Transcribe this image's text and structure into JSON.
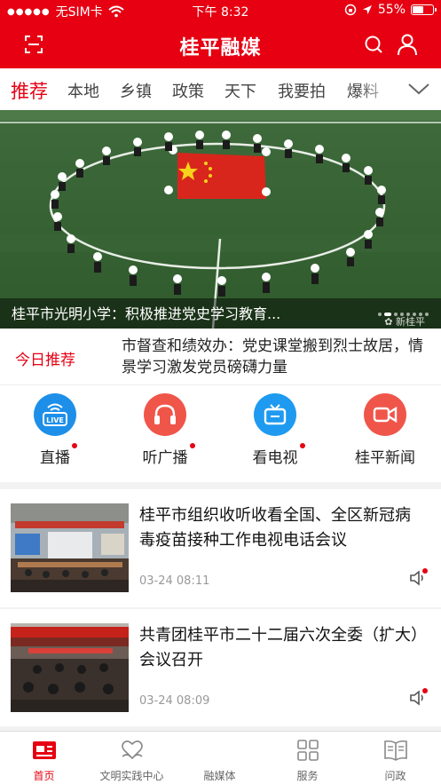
{
  "status_bar": {
    "carrier": "无SIM卡",
    "time": "下午 8:32",
    "battery": "55%",
    "battery_level": 0.55
  },
  "app_bar": {
    "title": "桂平融媒",
    "left_icon": "scan-icon",
    "right_icons": [
      "search-icon",
      "user-icon"
    ]
  },
  "tabs": {
    "items": [
      "推荐",
      "本地",
      "乡镇",
      "政策",
      "天下",
      "我要拍",
      "爆料"
    ],
    "active": "推荐",
    "more_icon": "chevron-down-icon"
  },
  "banner": {
    "caption": "桂平市光明小学：积极推进党史学习教育...",
    "watermark": "新桂平",
    "pages": 8,
    "current_page": 2
  },
  "headline": {
    "label": "今日推荐",
    "text": "市督查和绩效办：党史课堂搬到烈士故居，情景学习激发党员磅礴力量"
  },
  "quick_links": [
    {
      "label": "直播",
      "icon": "live-icon",
      "color": "#1e8fe8",
      "dot": true
    },
    {
      "label": "听广播",
      "icon": "headphones-icon",
      "color": "#f0554a",
      "dot": true
    },
    {
      "label": "看电视",
      "icon": "tv-icon",
      "color": "#1e9af0",
      "dot": true
    },
    {
      "label": "桂平新闻",
      "icon": "video-camera-icon",
      "color": "#f0554a",
      "dot": false
    }
  ],
  "news": [
    {
      "title": "桂平市组织收听收看全国、全区新冠病毒疫苗接种工作电视电话会议",
      "time": "03-24 08:11"
    },
    {
      "title": "共青团桂平市二十二届六次全委（扩大）会议召开",
      "time": "03-24 08:09"
    }
  ],
  "bottom_nav": {
    "items": [
      {
        "label": "首页",
        "icon": "home-icon"
      },
      {
        "label": "文明实践中心",
        "icon": "heart-hands-icon"
      },
      {
        "label": "融媒体",
        "icon": "media-icon"
      },
      {
        "label": "服务",
        "icon": "grid-icon"
      },
      {
        "label": "问政",
        "icon": "book-icon"
      }
    ],
    "active": "首页"
  },
  "colors": {
    "brand": "#e60012",
    "text": "#222222",
    "muted": "#999999"
  }
}
